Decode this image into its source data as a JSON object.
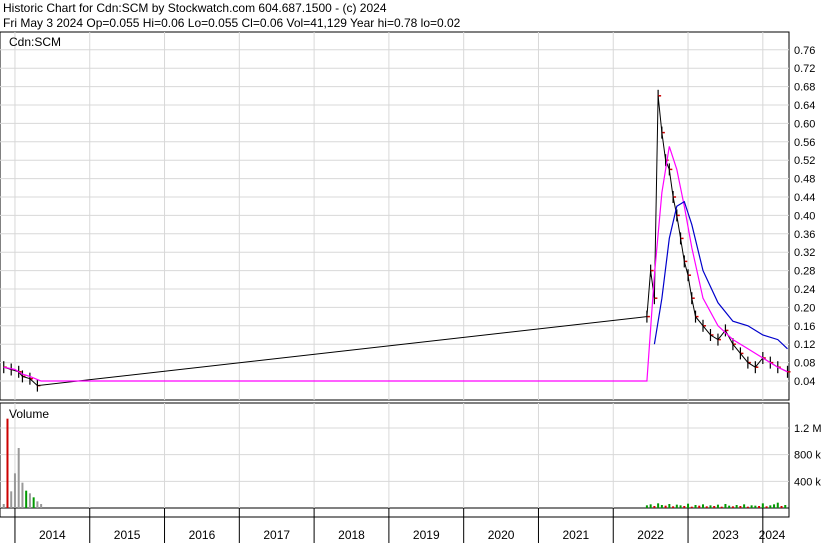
{
  "header": {
    "title": "Historic Chart for Cdn:SCM by Stockwatch.com 604.687.1500 - (c) 2024",
    "quote": "Fri May  3 2024   Op=0.055   Hi=0.06   Lo=0.055   Cl=0.06   Vol=41,129   Year hi=0.78   lo=0.02"
  },
  "chart_data": [
    {
      "type": "line",
      "title": "Cdn:SCM",
      "ylim": [
        0.02,
        0.78
      ],
      "y_ticks": [
        "0.76",
        "0.72",
        "0.68",
        "0.64",
        "0.60",
        "0.56",
        "0.52",
        "0.48",
        "0.44",
        "0.40",
        "0.36",
        "0.32",
        "0.28",
        "0.24",
        "0.20",
        "0.16",
        "0.12",
        "0.08",
        "0.04"
      ],
      "x_ticks": [
        "2014",
        "2015",
        "2016",
        "2017",
        "2018",
        "2019",
        "2020",
        "2021",
        "2022",
        "2023",
        "2024"
      ],
      "grid": true,
      "colors": {
        "price": "#000000",
        "close_tick": "#cc0000",
        "ma_short": "#ff00ff",
        "ma_long": "#0000cc"
      },
      "series": [
        {
          "role": "price",
          "x": [
            2013.85,
            2013.95,
            2014.05,
            2014.1,
            2014.2,
            2014.3,
            2022.45,
            2022.5,
            2022.55,
            2022.6,
            2022.65,
            2022.7,
            2022.75,
            2022.8,
            2022.85,
            2022.9,
            2022.95,
            2023.0,
            2023.05,
            2023.1,
            2023.2,
            2023.3,
            2023.4,
            2023.5,
            2023.6,
            2023.7,
            2023.8,
            2023.9,
            2024.0,
            2024.1,
            2024.2,
            2024.33
          ],
          "y": [
            0.07,
            0.065,
            0.06,
            0.05,
            0.045,
            0.03,
            0.18,
            0.28,
            0.22,
            0.66,
            0.58,
            0.52,
            0.5,
            0.44,
            0.4,
            0.35,
            0.3,
            0.27,
            0.22,
            0.18,
            0.16,
            0.14,
            0.13,
            0.15,
            0.12,
            0.1,
            0.08,
            0.07,
            0.09,
            0.08,
            0.07,
            0.06
          ]
        },
        {
          "role": "ma_short",
          "x": [
            2013.85,
            2014.0,
            2014.1,
            2014.2,
            2014.35,
            2015.0,
            2016.0,
            2017.0,
            2018.0,
            2019.0,
            2020.0,
            2021.0,
            2022.0,
            2022.45,
            2022.55,
            2022.65,
            2022.75,
            2022.85,
            2022.95,
            2023.05,
            2023.2,
            2023.4,
            2023.6,
            2023.8,
            2024.0,
            2024.2,
            2024.33
          ],
          "y": [
            0.07,
            0.065,
            0.055,
            0.05,
            0.04,
            0.04,
            0.04,
            0.04,
            0.04,
            0.04,
            0.04,
            0.04,
            0.04,
            0.04,
            0.27,
            0.45,
            0.55,
            0.5,
            0.42,
            0.33,
            0.22,
            0.16,
            0.13,
            0.11,
            0.09,
            0.07,
            0.06
          ]
        },
        {
          "role": "ma_long",
          "x": [
            2022.55,
            2022.65,
            2022.75,
            2022.85,
            2022.95,
            2023.05,
            2023.2,
            2023.4,
            2023.6,
            2023.8,
            2024.0,
            2024.2,
            2024.33
          ],
          "y": [
            0.12,
            0.22,
            0.35,
            0.42,
            0.43,
            0.38,
            0.28,
            0.21,
            0.17,
            0.16,
            0.14,
            0.13,
            0.11
          ]
        }
      ]
    },
    {
      "type": "bar",
      "title": "Volume",
      "ylim": [
        0,
        1500000
      ],
      "y_ticks": [
        "1.2 M",
        "800 k",
        "400 k"
      ],
      "colors": {
        "up": "#009900",
        "down": "#cc0000",
        "flat": "#999999"
      },
      "x": [
        2013.8,
        2013.85,
        2013.9,
        2013.95,
        2014.0,
        2014.05,
        2014.1,
        2014.15,
        2014.2,
        2014.25,
        2014.3,
        2014.35,
        2022.45,
        2022.5,
        2022.55,
        2022.6,
        2022.65,
        2022.7,
        2022.75,
        2022.8,
        2022.85,
        2022.9,
        2022.95,
        2023.0,
        2023.05,
        2023.1,
        2023.15,
        2023.2,
        2023.25,
        2023.3,
        2023.35,
        2023.4,
        2023.45,
        2023.5,
        2023.55,
        2023.6,
        2023.65,
        2023.7,
        2023.75,
        2023.8,
        2023.85,
        2023.9,
        2023.95,
        2024.0,
        2024.05,
        2024.1,
        2024.15,
        2024.2,
        2024.25,
        2024.3
      ],
      "values": [
        120000,
        60000,
        1340000,
        250000,
        520000,
        900000,
        380000,
        260000,
        220000,
        160000,
        100000,
        60000,
        40000,
        55000,
        30000,
        70000,
        45000,
        35000,
        60000,
        25000,
        50000,
        40000,
        30000,
        65000,
        20000,
        45000,
        35000,
        55000,
        25000,
        40000,
        30000,
        50000,
        20000,
        60000,
        35000,
        25000,
        45000,
        30000,
        55000,
        20000,
        40000,
        35000,
        30000,
        70000,
        25000,
        40000,
        55000,
        80000,
        30000,
        45000
      ],
      "directions": [
        "flat",
        "flat",
        "down",
        "flat",
        "flat",
        "flat",
        "flat",
        "up",
        "flat",
        "up",
        "flat",
        "flat",
        "up",
        "up",
        "down",
        "up",
        "up",
        "down",
        "up",
        "down",
        "up",
        "up",
        "down",
        "up",
        "down",
        "up",
        "down",
        "up",
        "down",
        "up",
        "down",
        "up",
        "down",
        "up",
        "up",
        "down",
        "up",
        "down",
        "up",
        "down",
        "up",
        "up",
        "down",
        "up",
        "down",
        "up",
        "up",
        "up",
        "down",
        "up"
      ]
    }
  ]
}
